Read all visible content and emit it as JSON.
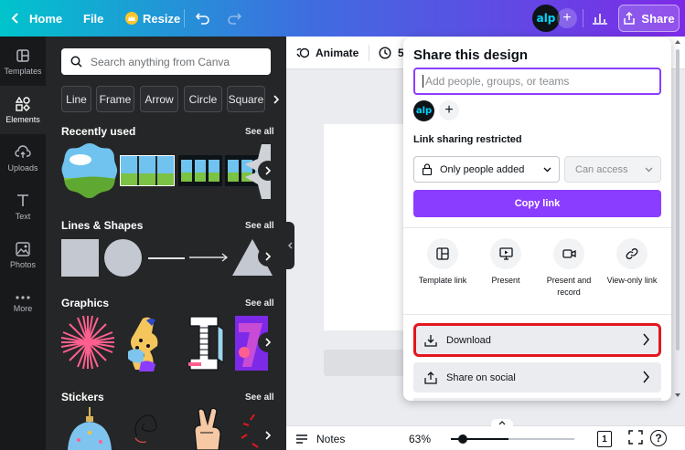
{
  "topbar": {
    "home_label": "Home",
    "file_label": "File",
    "resize_label": "Resize",
    "avatar_text": "alp",
    "share_label": "Share"
  },
  "rail": {
    "items": [
      {
        "label": "Templates",
        "icon": "templates-icon"
      },
      {
        "label": "Elements",
        "icon": "elements-icon"
      },
      {
        "label": "Uploads",
        "icon": "upload-icon"
      },
      {
        "label": "Text",
        "icon": "text-icon"
      },
      {
        "label": "Photos",
        "icon": "photos-icon"
      },
      {
        "label": "More",
        "icon": "more-icon"
      }
    ]
  },
  "panel": {
    "search_placeholder": "Search anything from Canva",
    "chips": [
      "Line",
      "Frame",
      "Arrow",
      "Circle",
      "Square"
    ],
    "see_all": "See all",
    "sections": [
      {
        "title": "Recently used"
      },
      {
        "title": "Lines & Shapes"
      },
      {
        "title": "Graphics"
      },
      {
        "title": "Stickers"
      }
    ]
  },
  "editor": {
    "animate_label": "Animate",
    "timer_label": "5",
    "notes_label": "Notes",
    "zoom": "63%",
    "page_count": "1"
  },
  "share": {
    "title": "Share this design",
    "input_placeholder": "Add people, groups, or teams",
    "link_label": "Link sharing restricted",
    "access_value": "Only people added",
    "permission_value": "Can access",
    "copy_label": "Copy link",
    "actions": [
      {
        "label": "Template link",
        "icon": "template-link-icon"
      },
      {
        "label": "Present",
        "icon": "present-icon"
      },
      {
        "label": "Present and record",
        "icon": "camera-icon"
      },
      {
        "label": "View-only link",
        "icon": "link-icon"
      }
    ],
    "download_label": "Download",
    "social_label": "Share on social"
  },
  "colors": {
    "accent": "#8b3dff",
    "highlight": "#e3161f",
    "panel_bg": "#252627",
    "rail_bg": "#18191b"
  }
}
